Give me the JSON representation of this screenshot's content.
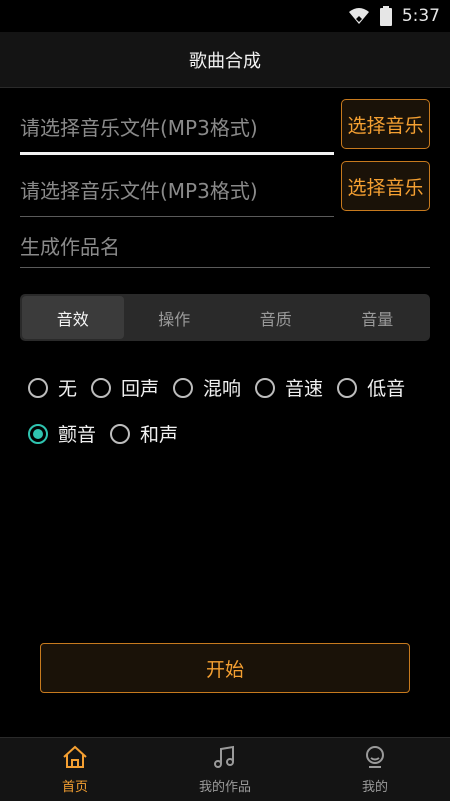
{
  "status_bar": {
    "time": "5:37",
    "icons": [
      "wifi-icon",
      "battery-icon"
    ]
  },
  "header": {
    "title": "歌曲合成"
  },
  "files": [
    {
      "placeholder": "请选择音乐文件(MP3格式)",
      "button": "选择音乐"
    },
    {
      "placeholder": "请选择音乐文件(MP3格式)",
      "button": "选择音乐"
    }
  ],
  "name_field": {
    "placeholder": "生成作品名"
  },
  "tabs": [
    "音效",
    "操作",
    "音质",
    "音量"
  ],
  "active_tab": "音效",
  "effects": {
    "row1": [
      "无",
      "回声",
      "混响",
      "音速",
      "低音"
    ],
    "row2": [
      "颤音",
      "和声"
    ],
    "selected": "颤音"
  },
  "start_button": "开始",
  "bottom_nav": [
    {
      "label": "首页",
      "icon": "home-icon",
      "active": true
    },
    {
      "label": "我的作品",
      "icon": "music-note-icon",
      "active": false
    },
    {
      "label": "我的",
      "icon": "user-icon",
      "active": false
    }
  ],
  "colors": {
    "accent": "#f5a032",
    "radio_checked": "#2fc4b0",
    "background": "#000000"
  }
}
